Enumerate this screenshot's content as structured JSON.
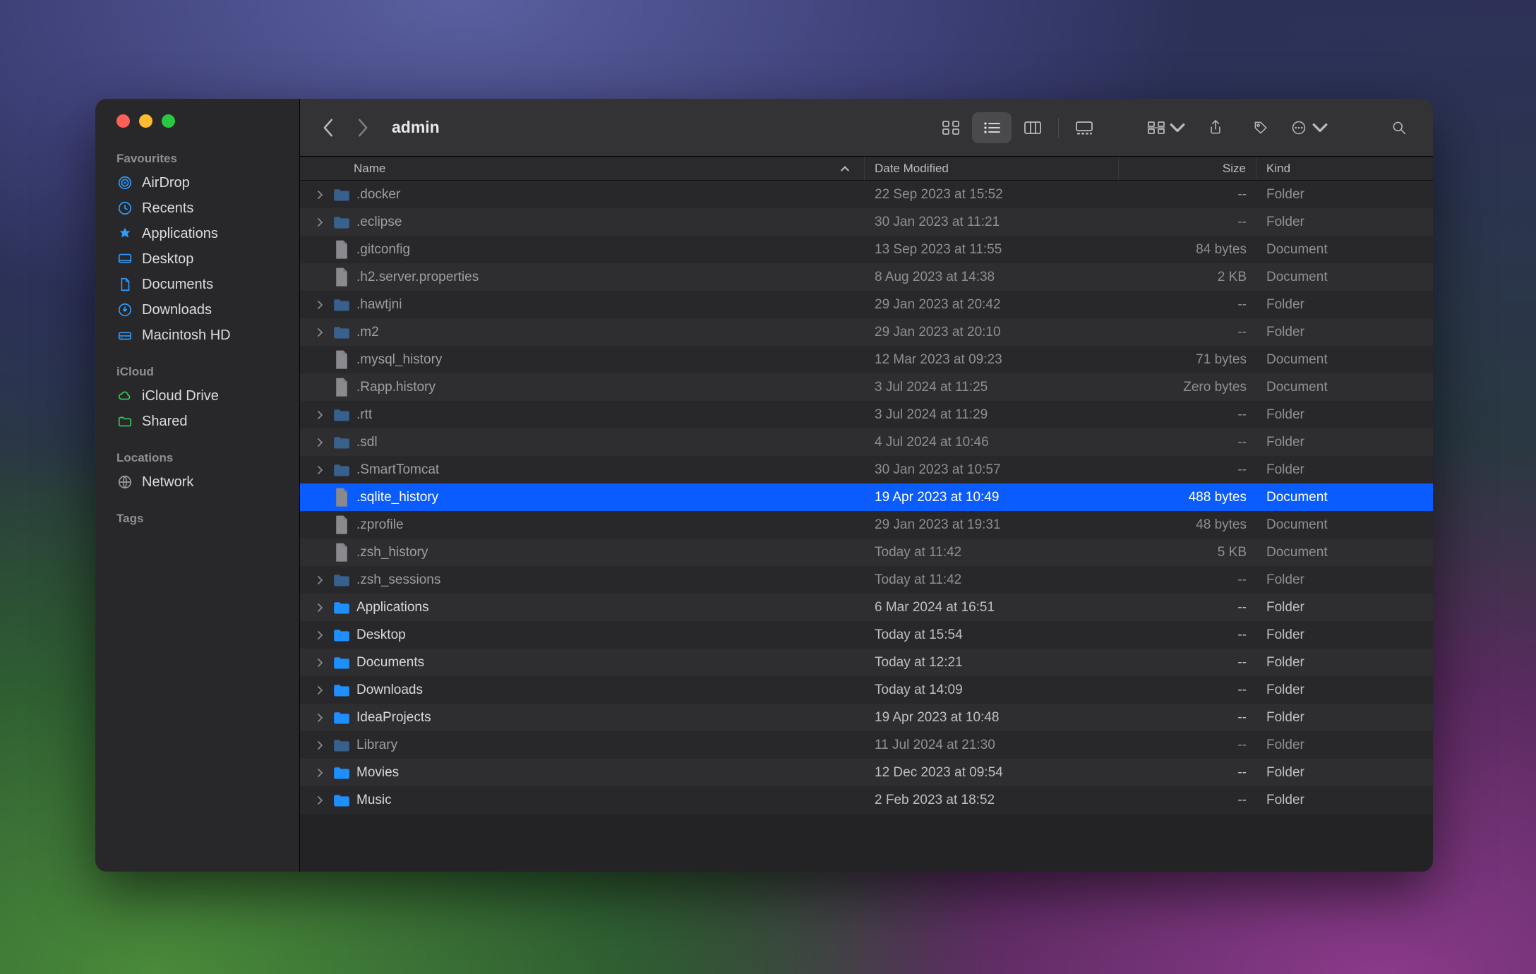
{
  "window": {
    "title": "admin"
  },
  "sidebar": {
    "sections": [
      {
        "title": "Favourites",
        "items": [
          {
            "label": "AirDrop",
            "icon": "airdrop"
          },
          {
            "label": "Recents",
            "icon": "clock"
          },
          {
            "label": "Applications",
            "icon": "apps"
          },
          {
            "label": "Desktop",
            "icon": "desktop"
          },
          {
            "label": "Documents",
            "icon": "doc"
          },
          {
            "label": "Downloads",
            "icon": "download"
          },
          {
            "label": "Macintosh HD",
            "icon": "drive"
          }
        ]
      },
      {
        "title": "iCloud",
        "items": [
          {
            "label": "iCloud Drive",
            "icon": "cloud"
          },
          {
            "label": "Shared",
            "icon": "sharedfolder"
          }
        ]
      },
      {
        "title": "Locations",
        "items": [
          {
            "label": "Network",
            "icon": "globe"
          }
        ]
      },
      {
        "title": "Tags",
        "items": []
      }
    ]
  },
  "columns": {
    "name": "Name",
    "date": "Date Modified",
    "size": "Size",
    "kind": "Kind"
  },
  "size_placeholder": "--",
  "rows": [
    {
      "name": ".docker",
      "date": "22 Sep 2023 at 15:52",
      "size": "--",
      "kind": "Folder",
      "type": "folder",
      "expandable": true,
      "hidden": true
    },
    {
      "name": ".eclipse",
      "date": "30 Jan 2023 at 11:21",
      "size": "--",
      "kind": "Folder",
      "type": "folder",
      "expandable": true,
      "hidden": true
    },
    {
      "name": ".gitconfig",
      "date": "13 Sep 2023 at 11:55",
      "size": "84 bytes",
      "kind": "Document",
      "type": "doc",
      "expandable": false,
      "hidden": true
    },
    {
      "name": ".h2.server.properties",
      "date": "8 Aug 2023 at 14:38",
      "size": "2 KB",
      "kind": "Document",
      "type": "doc",
      "expandable": false,
      "hidden": true
    },
    {
      "name": ".hawtjni",
      "date": "29 Jan 2023 at 20:42",
      "size": "--",
      "kind": "Folder",
      "type": "folder",
      "expandable": true,
      "hidden": true
    },
    {
      "name": ".m2",
      "date": "29 Jan 2023 at 20:10",
      "size": "--",
      "kind": "Folder",
      "type": "folder",
      "expandable": true,
      "hidden": true
    },
    {
      "name": ".mysql_history",
      "date": "12 Mar 2023 at 09:23",
      "size": "71 bytes",
      "kind": "Document",
      "type": "doc",
      "expandable": false,
      "hidden": true
    },
    {
      "name": ".Rapp.history",
      "date": "3 Jul 2024 at 11:25",
      "size": "Zero bytes",
      "kind": "Document",
      "type": "doc",
      "expandable": false,
      "hidden": true
    },
    {
      "name": ".rtt",
      "date": "3 Jul 2024 at 11:29",
      "size": "--",
      "kind": "Folder",
      "type": "folder",
      "expandable": true,
      "hidden": true
    },
    {
      "name": ".sdl",
      "date": "4 Jul 2024 at 10:46",
      "size": "--",
      "kind": "Folder",
      "type": "folder",
      "expandable": true,
      "hidden": true
    },
    {
      "name": ".SmartTomcat",
      "date": "30 Jan 2023 at 10:57",
      "size": "--",
      "kind": "Folder",
      "type": "folder",
      "expandable": true,
      "hidden": true
    },
    {
      "name": ".sqlite_history",
      "date": "19 Apr 2023 at 10:49",
      "size": "488 bytes",
      "kind": "Document",
      "type": "doc",
      "expandable": false,
      "hidden": true,
      "selected": true
    },
    {
      "name": ".zprofile",
      "date": "29 Jan 2023 at 19:31",
      "size": "48 bytes",
      "kind": "Document",
      "type": "doc",
      "expandable": false,
      "hidden": true
    },
    {
      "name": ".zsh_history",
      "date": "Today at 11:42",
      "size": "5 KB",
      "kind": "Document",
      "type": "doc",
      "expandable": false,
      "hidden": true
    },
    {
      "name": ".zsh_sessions",
      "date": "Today at 11:42",
      "size": "--",
      "kind": "Folder",
      "type": "folder",
      "expandable": true,
      "hidden": true
    },
    {
      "name": "Applications",
      "date": "6 Mar 2024 at 16:51",
      "size": "--",
      "kind": "Folder",
      "type": "folder",
      "expandable": true,
      "hidden": false
    },
    {
      "name": "Desktop",
      "date": "Today at 15:54",
      "size": "--",
      "kind": "Folder",
      "type": "folder",
      "expandable": true,
      "hidden": false
    },
    {
      "name": "Documents",
      "date": "Today at 12:21",
      "size": "--",
      "kind": "Folder",
      "type": "folder",
      "expandable": true,
      "hidden": false
    },
    {
      "name": "Downloads",
      "date": "Today at 14:09",
      "size": "--",
      "kind": "Folder",
      "type": "folder",
      "expandable": true,
      "hidden": false
    },
    {
      "name": "IdeaProjects",
      "date": "19 Apr 2023 at 10:48",
      "size": "--",
      "kind": "Folder",
      "type": "folder",
      "expandable": true,
      "hidden": false
    },
    {
      "name": "Library",
      "date": "11 Jul 2024 at 21:30",
      "size": "--",
      "kind": "Folder",
      "type": "folder",
      "expandable": true,
      "hidden": false,
      "greyed": true
    },
    {
      "name": "Movies",
      "date": "12 Dec 2023 at 09:54",
      "size": "--",
      "kind": "Folder",
      "type": "folder",
      "expandable": true,
      "hidden": false
    },
    {
      "name": "Music",
      "date": "2 Feb 2023 at 18:52",
      "size": "--",
      "kind": "Folder",
      "type": "folder",
      "expandable": true,
      "hidden": false
    }
  ]
}
